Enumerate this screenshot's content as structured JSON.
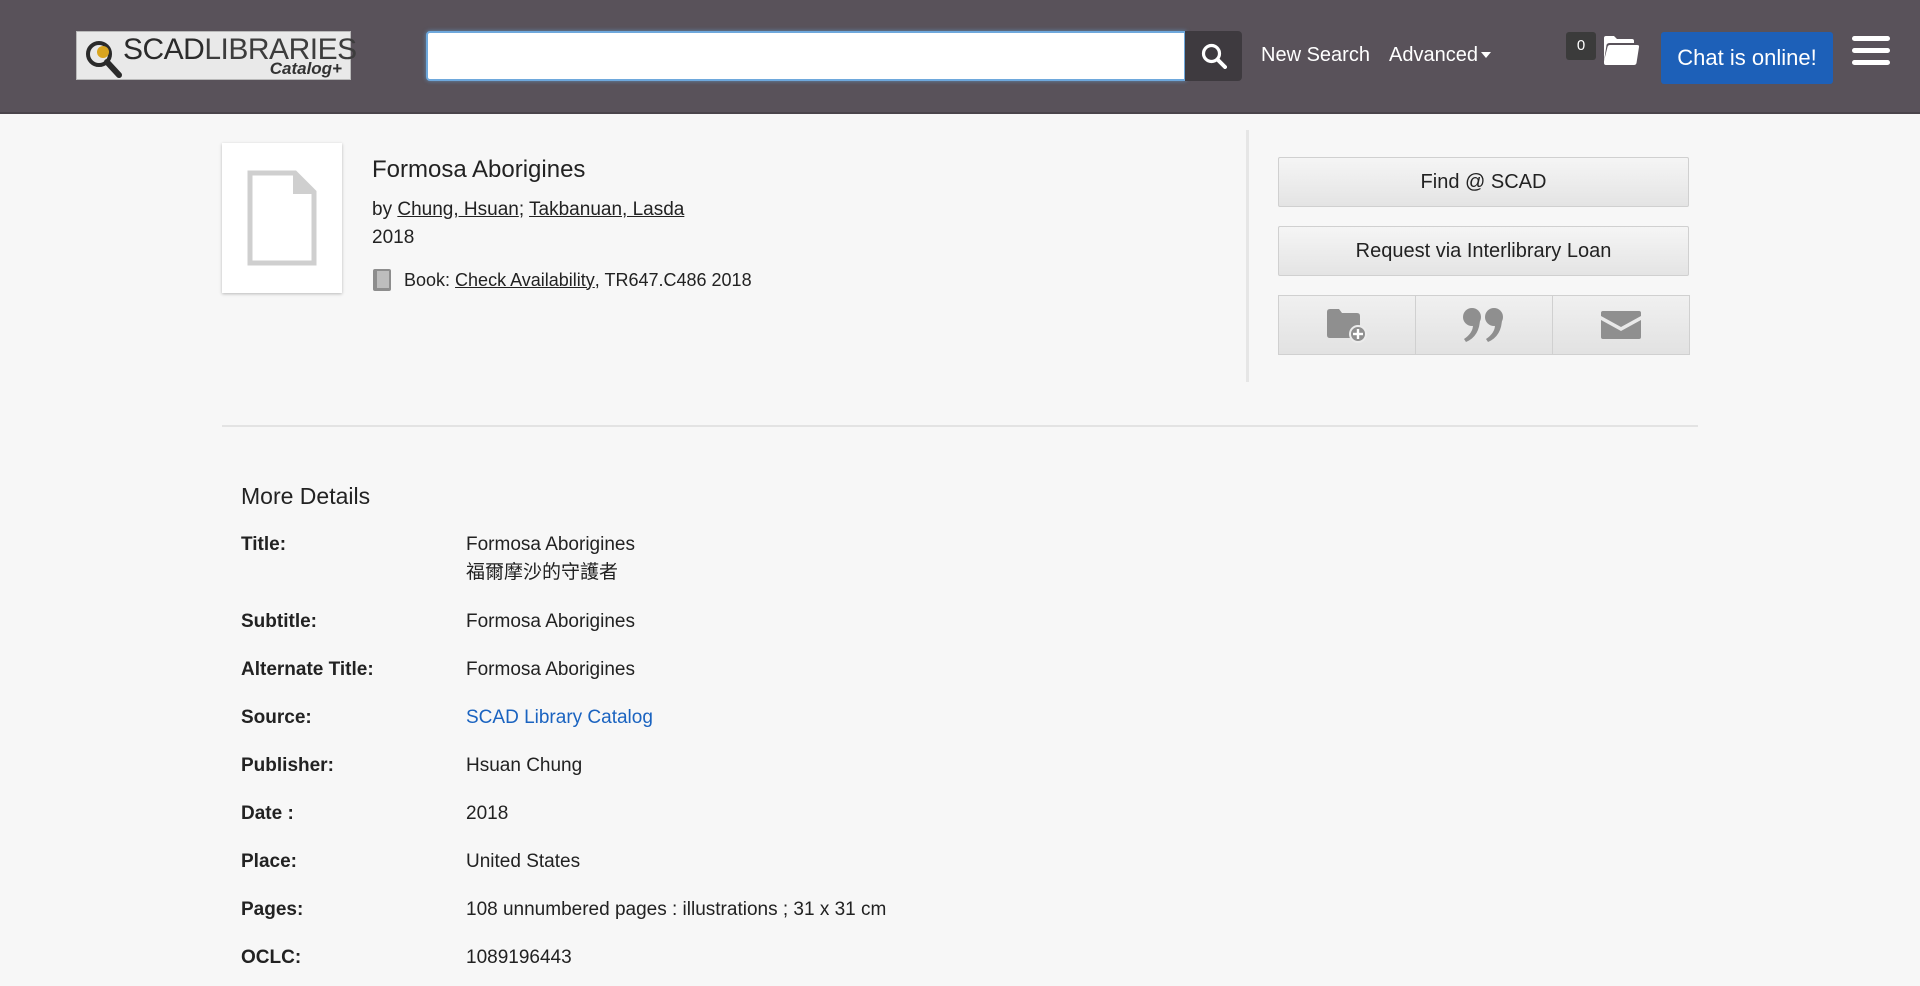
{
  "header": {
    "logo_main_a": "SCAD",
    "logo_main_b": "LIBRARIES",
    "logo_sub": "Catalog+",
    "search_placeholder": "",
    "new_search": "New Search",
    "advanced": "Advanced",
    "cart_count": "0",
    "chat": "Chat is online!"
  },
  "record": {
    "title": "Formosa Aborigines",
    "by": "by ",
    "author1": "Chung, Hsuan",
    "sep": "; ",
    "author2": "Takbanuan, Lasda",
    "year": "2018",
    "format_label": "Book: ",
    "availability": "Check Availability",
    "call_number": ", TR647.C486 2018"
  },
  "actions": {
    "find": "Find @ SCAD",
    "ill": "Request via Interlibrary Loan"
  },
  "details": {
    "heading": "More Details",
    "rows": [
      {
        "label": "Title:",
        "value": "Formosa Aborigines",
        "value2": "福爾摩沙的守護者"
      },
      {
        "label": "Subtitle:",
        "value": "Formosa Aborigines"
      },
      {
        "label": "Alternate Title:",
        "value": "Formosa Aborigines"
      },
      {
        "label": "Source:",
        "value": "SCAD Library Catalog"
      },
      {
        "label": "Publisher:",
        "value": "Hsuan Chung"
      },
      {
        "label": "Date :",
        "value": "2018"
      },
      {
        "label": "Place:",
        "value": "United States"
      },
      {
        "label": "Pages:",
        "value": "108 unnumbered pages : illustrations ; 31 x 31 cm"
      },
      {
        "label": "OCLC:",
        "value": "1089196443"
      }
    ]
  },
  "colors": {
    "header_bg": "#59525a",
    "chat_bg": "#1d60b8",
    "link_blue": "#1a63c0"
  },
  "icons": [
    "search-icon",
    "folder-icon",
    "hamburger-menu-icon",
    "document-icon",
    "book-icon",
    "add-to-folder-icon",
    "cite-quote-icon",
    "email-icon"
  ]
}
